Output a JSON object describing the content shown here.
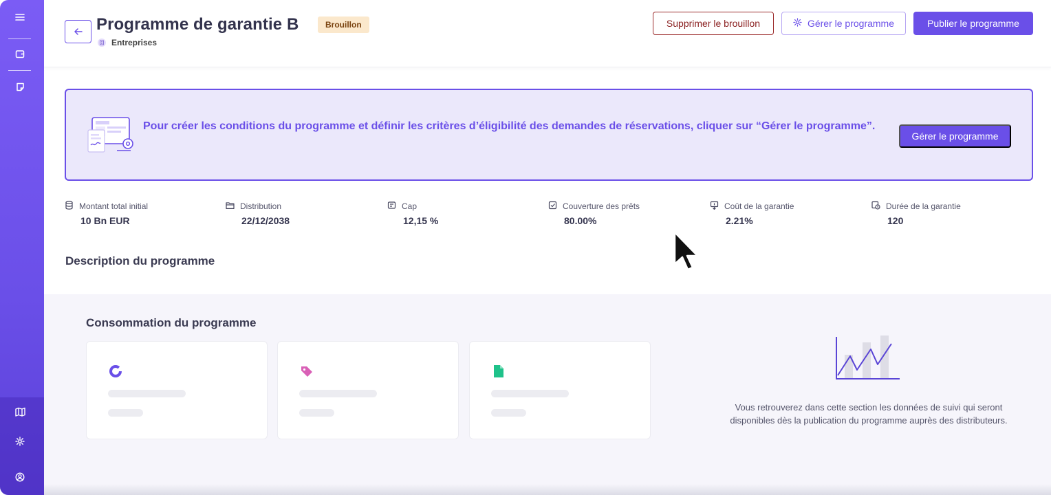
{
  "header": {
    "title": "Programme de garantie B",
    "status_badge": "Brouillon",
    "subtitle": "Entreprises",
    "actions": {
      "delete_draft": "Supprimer le brouillon",
      "manage_program": "Gérer le programme",
      "publish_program": "Publier le programme"
    }
  },
  "banner": {
    "text": "Pour créer les conditions du programme et définir les critères d’éligibilité des demandes de réservations, cliquer sur “Gérer le programme”.",
    "button_label": "Gérer le programme"
  },
  "stats": [
    {
      "label": "Montant total initial",
      "value": "10 Bn EUR",
      "icon": "database-icon"
    },
    {
      "label": "Distribution",
      "value": "22/12/2038",
      "icon": "folder-icon"
    },
    {
      "label": "Cap",
      "value": "12,15 %",
      "icon": "cap-icon"
    },
    {
      "label": "Couverture des prêts",
      "value": "80.00%",
      "icon": "coverage-icon"
    },
    {
      "label": "Coût de la garantie",
      "value": "2.21%",
      "icon": "cost-icon"
    },
    {
      "label": "Durée de la garantie",
      "value": "120",
      "icon": "duration-icon"
    }
  ],
  "description": {
    "title": "Description du programme"
  },
  "consumption": {
    "title": "Consommation du programme",
    "cards": [
      {
        "icon": "donut-chart-icon",
        "color": "#6a4fe8"
      },
      {
        "icon": "tag-icon",
        "color": "#d960b6"
      },
      {
        "icon": "document-icon",
        "color": "#1fc28a"
      }
    ],
    "empty_state_text": "Vous retrouverez dans cette section les données de suivi qui seront disponibles dès la publication du programme auprès des distributeurs."
  },
  "colors": {
    "primary": "#6a4fe8",
    "danger": "#8a1f1f",
    "badge_bg": "#fbe8cc",
    "banner_bg": "#ebe8fb"
  }
}
